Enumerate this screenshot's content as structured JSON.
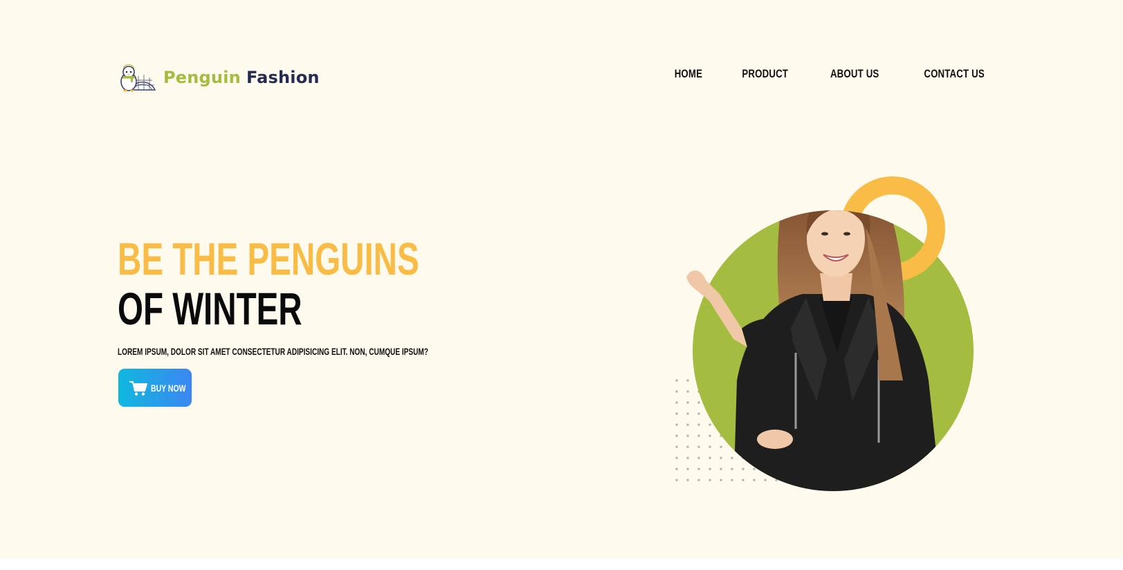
{
  "brand": {
    "name_first": "Penguin",
    "name_second": "Fashion",
    "logo_icon": "penguin-igloo-logo",
    "colors": {
      "first": "#a4bc3f",
      "second": "#262b52"
    }
  },
  "nav": {
    "items": [
      {
        "label": "HOME"
      },
      {
        "label": "PRODUCT"
      },
      {
        "label": "ABOUT US"
      },
      {
        "label": "CONTACT US"
      }
    ]
  },
  "hero": {
    "title_line1": "BE THE PENGUINS",
    "title_line2": "OF WINTER",
    "subtitle": "LOREM IPSUM, DOLOR SIT AMET CONSECTETUR ADIPISICING ELIT. NON, CUMQUE IPSUM?",
    "cta_label": "BUY NOW",
    "cta_icon": "shopping-cart-icon",
    "colors": {
      "accent_yellow": "#f9bc46",
      "accent_green": "#a4bc3f",
      "button_start": "#0fb9df",
      "button_end": "#3c86f1",
      "background": "#fffaee"
    }
  },
  "visual": {
    "model_image": "woman-in-black-leather-jacket",
    "shapes": [
      "green-circle",
      "yellow-ring",
      "dot-grid"
    ]
  }
}
